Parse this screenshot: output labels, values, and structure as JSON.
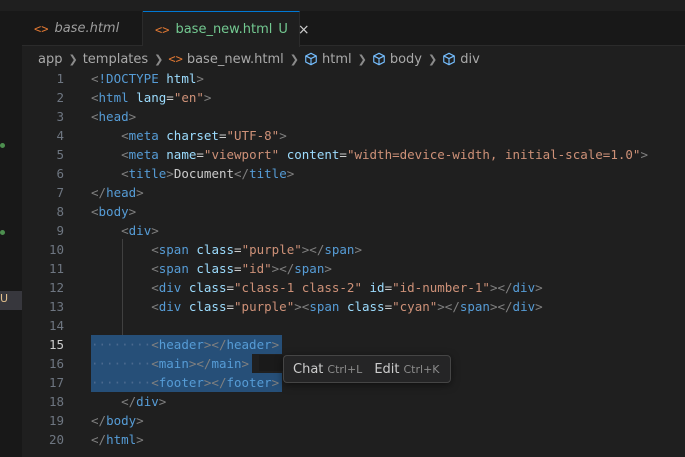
{
  "tabs": [
    {
      "icon": "<>",
      "label": "base.html",
      "active": false
    },
    {
      "icon": "<>",
      "label": "base_new.html",
      "status": "U",
      "active": true,
      "close": "×"
    }
  ],
  "left_strip": {
    "marker": "U"
  },
  "breadcrumb": [
    "app",
    "templates",
    "base_new.html",
    "html",
    "body",
    "div"
  ],
  "editor": {
    "active_line": 15,
    "lines": [
      {
        "n": "1",
        "indent": "",
        "toks": [
          [
            "p",
            "<"
          ],
          [
            "t",
            "!DOCTYPE"
          ],
          [
            "x",
            " "
          ],
          [
            "a",
            "html"
          ],
          [
            "p",
            ">"
          ]
        ]
      },
      {
        "n": "2",
        "indent": "",
        "toks": [
          [
            "p",
            "<"
          ],
          [
            "t",
            "html"
          ],
          [
            "x",
            " "
          ],
          [
            "a",
            "lang"
          ],
          [
            "x",
            "="
          ],
          [
            "v",
            "\"en\""
          ],
          [
            "p",
            ">"
          ]
        ]
      },
      {
        "n": "3",
        "indent": "",
        "toks": [
          [
            "p",
            "<"
          ],
          [
            "t",
            "head"
          ],
          [
            "p",
            ">"
          ]
        ]
      },
      {
        "n": "4",
        "indent": "    ",
        "toks": [
          [
            "p",
            "<"
          ],
          [
            "t",
            "meta"
          ],
          [
            "x",
            " "
          ],
          [
            "a",
            "charset"
          ],
          [
            "x",
            "="
          ],
          [
            "v",
            "\"UTF-8\""
          ],
          [
            "p",
            ">"
          ]
        ]
      },
      {
        "n": "5",
        "indent": "    ",
        "toks": [
          [
            "p",
            "<"
          ],
          [
            "t",
            "meta"
          ],
          [
            "x",
            " "
          ],
          [
            "a",
            "name"
          ],
          [
            "x",
            "="
          ],
          [
            "v",
            "\"viewport\""
          ],
          [
            "x",
            " "
          ],
          [
            "a",
            "content"
          ],
          [
            "x",
            "="
          ],
          [
            "v",
            "\"width=device-width, initial-scale=1.0\""
          ],
          [
            "p",
            ">"
          ]
        ]
      },
      {
        "n": "6",
        "indent": "    ",
        "toks": [
          [
            "p",
            "<"
          ],
          [
            "t",
            "title"
          ],
          [
            "p",
            ">"
          ],
          [
            "x",
            "Document"
          ],
          [
            "p",
            "</"
          ],
          [
            "t",
            "title"
          ],
          [
            "p",
            ">"
          ]
        ]
      },
      {
        "n": "7",
        "indent": "",
        "toks": [
          [
            "p",
            "</"
          ],
          [
            "t",
            "head"
          ],
          [
            "p",
            ">"
          ]
        ]
      },
      {
        "n": "8",
        "indent": "",
        "toks": [
          [
            "p",
            "<"
          ],
          [
            "t",
            "body"
          ],
          [
            "p",
            ">"
          ]
        ]
      },
      {
        "n": "9",
        "indent": "    ",
        "toks": [
          [
            "p",
            "<"
          ],
          [
            "t",
            "div"
          ],
          [
            "p",
            ">"
          ]
        ]
      },
      {
        "n": "10",
        "indent": "        ",
        "toks": [
          [
            "p",
            "<"
          ],
          [
            "t",
            "span"
          ],
          [
            "x",
            " "
          ],
          [
            "a",
            "class"
          ],
          [
            "x",
            "="
          ],
          [
            "v",
            "\"purple\""
          ],
          [
            "p",
            "></"
          ],
          [
            "t",
            "span"
          ],
          [
            "p",
            ">"
          ]
        ]
      },
      {
        "n": "11",
        "indent": "        ",
        "toks": [
          [
            "p",
            "<"
          ],
          [
            "t",
            "span"
          ],
          [
            "x",
            " "
          ],
          [
            "a",
            "class"
          ],
          [
            "x",
            "="
          ],
          [
            "v",
            "\"id\""
          ],
          [
            "p",
            "></"
          ],
          [
            "t",
            "span"
          ],
          [
            "p",
            ">"
          ]
        ]
      },
      {
        "n": "12",
        "indent": "        ",
        "toks": [
          [
            "p",
            "<"
          ],
          [
            "t",
            "div"
          ],
          [
            "x",
            " "
          ],
          [
            "a",
            "class"
          ],
          [
            "x",
            "="
          ],
          [
            "v",
            "\"class-1 class-2\""
          ],
          [
            "x",
            " "
          ],
          [
            "a",
            "id"
          ],
          [
            "x",
            "="
          ],
          [
            "v",
            "\"id-number-1\""
          ],
          [
            "p",
            "></"
          ],
          [
            "t",
            "div"
          ],
          [
            "p",
            ">"
          ]
        ]
      },
      {
        "n": "13",
        "indent": "        ",
        "toks": [
          [
            "p",
            "<"
          ],
          [
            "t",
            "div"
          ],
          [
            "x",
            " "
          ],
          [
            "a",
            "class"
          ],
          [
            "x",
            "="
          ],
          [
            "v",
            "\"purple\""
          ],
          [
            "p",
            ">"
          ],
          [
            "p",
            "<"
          ],
          [
            "t",
            "span"
          ],
          [
            "x",
            " "
          ],
          [
            "a",
            "class"
          ],
          [
            "x",
            "="
          ],
          [
            "v",
            "\"cyan\""
          ],
          [
            "p",
            "></"
          ],
          [
            "t",
            "span"
          ],
          [
            "p",
            "></"
          ],
          [
            "t",
            "div"
          ],
          [
            "p",
            ">"
          ]
        ]
      },
      {
        "n": "14",
        "indent": "",
        "toks": []
      },
      {
        "n": "15",
        "indent": "········",
        "sel": true,
        "toks": [
          [
            "p",
            "<"
          ],
          [
            "t",
            "header"
          ],
          [
            "p",
            "></"
          ],
          [
            "t",
            "header"
          ],
          [
            "p",
            ">"
          ]
        ]
      },
      {
        "n": "16",
        "indent": "········",
        "sel": true,
        "toks": [
          [
            "p",
            "<"
          ],
          [
            "t",
            "main"
          ],
          [
            "p",
            "></"
          ],
          [
            "t",
            "main"
          ],
          [
            "p",
            ">"
          ]
        ]
      },
      {
        "n": "17",
        "indent": "········",
        "sel": true,
        "toks": [
          [
            "p",
            "<"
          ],
          [
            "t",
            "footer"
          ],
          [
            "p",
            "></"
          ],
          [
            "t",
            "footer"
          ],
          [
            "p",
            ">"
          ]
        ]
      },
      {
        "n": "18",
        "indent": "    ",
        "toks": [
          [
            "p",
            "</"
          ],
          [
            "t",
            "div"
          ],
          [
            "p",
            ">"
          ]
        ]
      },
      {
        "n": "19",
        "indent": "",
        "toks": [
          [
            "p",
            "</"
          ],
          [
            "t",
            "body"
          ],
          [
            "p",
            ">"
          ]
        ]
      },
      {
        "n": "20",
        "indent": "",
        "toks": [
          [
            "p",
            "</"
          ],
          [
            "t",
            "html"
          ],
          [
            "p",
            ">"
          ]
        ]
      }
    ]
  },
  "popup": {
    "chat_label": "Chat",
    "chat_shortcut": "Ctrl+L",
    "edit_label": "Edit",
    "edit_shortcut": "Ctrl+K"
  },
  "colors": {
    "tag": "#569cd6",
    "attr": "#9cdcfe",
    "value": "#ce9178",
    "punct": "#808080",
    "accent": "#0078d4",
    "untracked": "#73c991"
  }
}
